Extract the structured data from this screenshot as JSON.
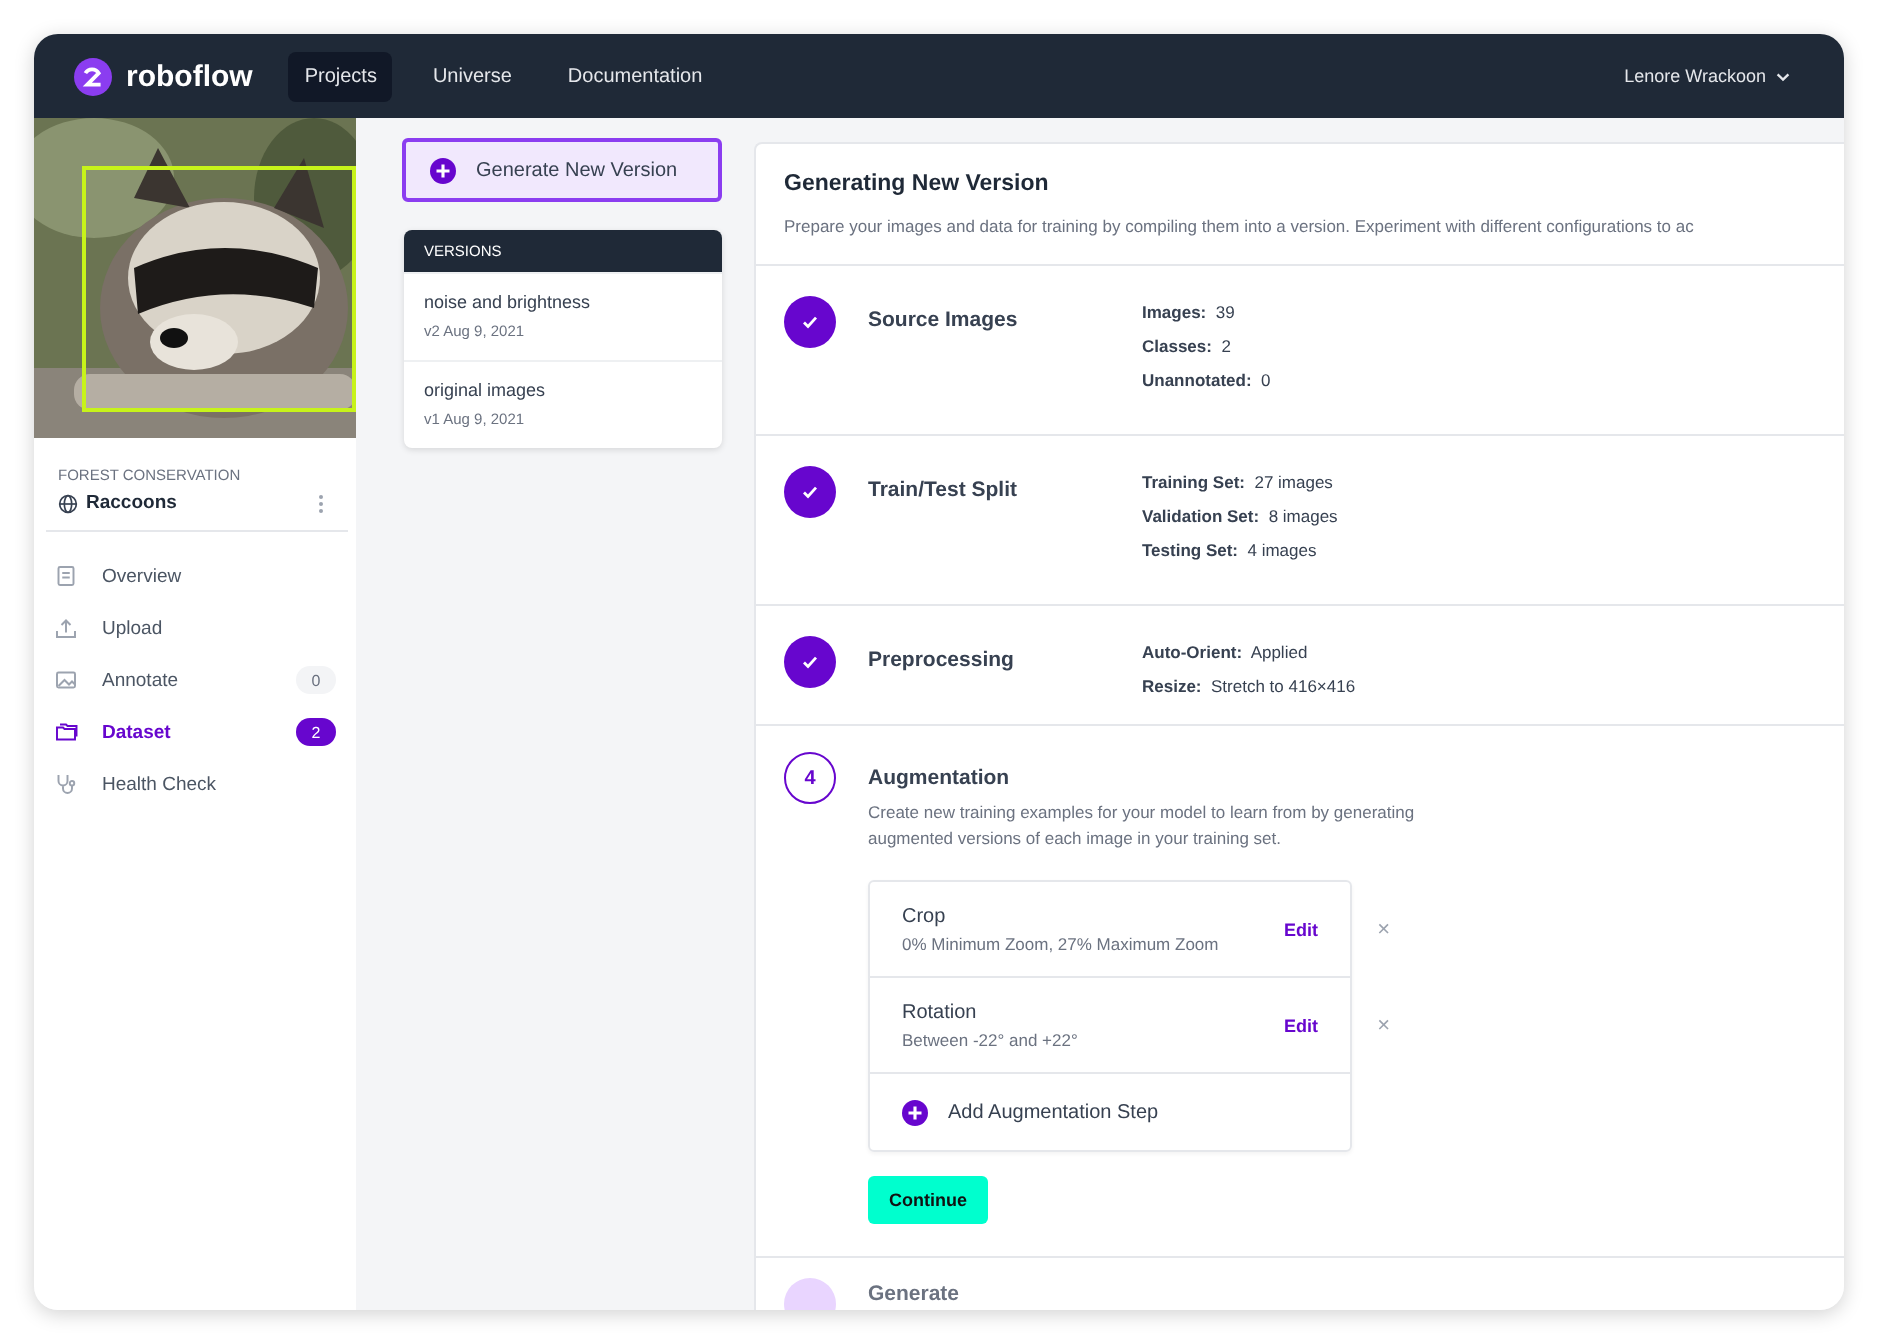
{
  "nav": {
    "logo": "roboflow",
    "links": [
      {
        "label": "Projects",
        "selected": true
      },
      {
        "label": "Universe",
        "selected": false
      },
      {
        "label": "Documentation",
        "selected": false
      }
    ],
    "user": "Lenore Wrackoon"
  },
  "sidebar": {
    "workspace": "FOREST CONSERVATION",
    "project": "Raccoons",
    "items": [
      {
        "kind": "overview",
        "label": "Overview",
        "selected": false
      },
      {
        "kind": "upload",
        "label": "Upload",
        "selected": false
      },
      {
        "kind": "annotate",
        "label": "Annotate",
        "count": "0",
        "selected": false
      },
      {
        "kind": "dataset",
        "label": "Dataset",
        "count": "2",
        "selected": true
      },
      {
        "kind": "health",
        "label": "Health Check",
        "selected": false
      }
    ]
  },
  "generate_button": "Generate New Version",
  "versions": {
    "title": "VERSIONS",
    "items": [
      {
        "name": "noise and brightness",
        "meta": "v2 Aug 9, 2021"
      },
      {
        "name": "original images",
        "meta": "v1 Aug 9, 2021"
      }
    ]
  },
  "main": {
    "title": "Generating New Version",
    "description": "Prepare your images and data for training by compiling them into a version. Experiment with different configurations to ac",
    "steps": [
      {
        "kind": "done",
        "title": "Source Images",
        "details": [
          {
            "label": "Images:",
            "value": "39"
          },
          {
            "label": "Classes:",
            "value": "2"
          },
          {
            "label": "Unannotated:",
            "value": "0"
          }
        ]
      },
      {
        "kind": "done",
        "title": "Train/Test Split",
        "details": [
          {
            "label": "Training Set:",
            "value": "27 images"
          },
          {
            "label": "Validation Set:",
            "value": "8 images"
          },
          {
            "label": "Testing Set:",
            "value": "4 images"
          }
        ]
      },
      {
        "kind": "done",
        "title": "Preprocessing",
        "details": [
          {
            "label": "Auto-Orient:",
            "value": "Applied"
          },
          {
            "label": "Resize:",
            "value": "Stretch to 416×416"
          }
        ]
      },
      {
        "kind": "current",
        "number": "4",
        "title": "Augmentation",
        "description": "Create new training examples for your model to learn from by generating augmented versions of each image in your training set.",
        "augmentations": [
          {
            "name": "Crop",
            "detail": "0% Minimum Zoom, 27% Maximum Zoom",
            "action": "Edit",
            "remove": "×"
          },
          {
            "name": "Rotation",
            "detail": "Between -22° and +22°",
            "action": "Edit",
            "remove": "×"
          }
        ],
        "add_label": "Add Augmentation Step",
        "continue_label": "Continue"
      },
      {
        "kind": "pending",
        "title": "Generate"
      }
    ]
  }
}
